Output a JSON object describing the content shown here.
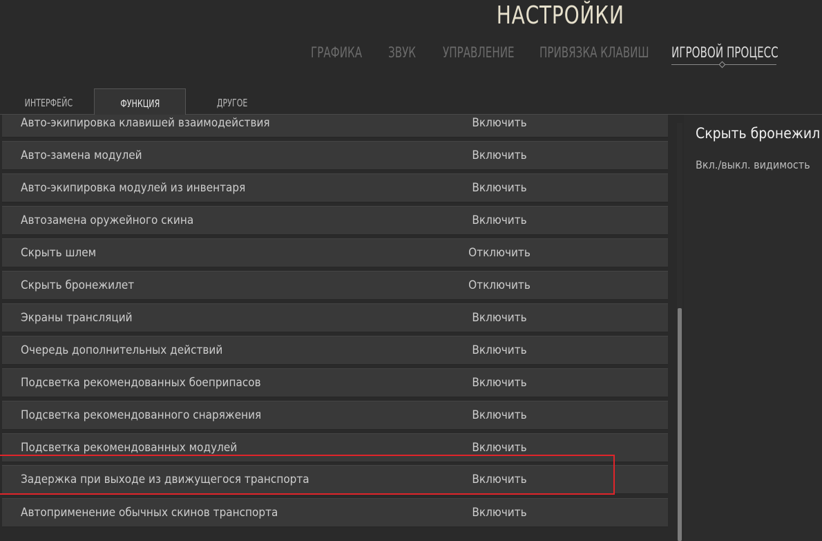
{
  "header": {
    "title": "НАСТРОЙКИ"
  },
  "main_tabs": [
    {
      "label": "ГРАФИКА",
      "active": false
    },
    {
      "label": "ЗВУК",
      "active": false
    },
    {
      "label": "УПРАВЛЕНИЕ",
      "active": false
    },
    {
      "label": "ПРИВЯЗКА КЛАВИШ",
      "active": false
    },
    {
      "label": "ИГРОВОЙ ПРОЦЕСС",
      "active": true
    }
  ],
  "sub_tabs": [
    {
      "label": "ИНТЕРФЕЙС",
      "active": false
    },
    {
      "label": "ФУНКЦИЯ",
      "active": true
    },
    {
      "label": "ДРУГОЕ",
      "active": false
    }
  ],
  "settings": [
    {
      "label": "Авто-экипировка клавишей взаимодействия",
      "value": "Включить"
    },
    {
      "label": "Авто-замена модулей",
      "value": "Включить"
    },
    {
      "label": "Авто-экипировка модулей из инвентаря",
      "value": "Включить"
    },
    {
      "label": "Автозамена оружейного скина",
      "value": "Включить"
    },
    {
      "label": "Скрыть шлем",
      "value": "Отключить"
    },
    {
      "label": "Скрыть бронежилет",
      "value": "Отключить"
    },
    {
      "label": "Экраны трансляций",
      "value": "Включить"
    },
    {
      "label": "Очередь дополнительных действий",
      "value": "Включить"
    },
    {
      "label": "Подсветка рекомендованных боеприпасов",
      "value": "Включить"
    },
    {
      "label": "Подсветка рекомендованного снаряжения",
      "value": "Включить"
    },
    {
      "label": "Подсветка рекомендованных модулей",
      "value": "Включить"
    },
    {
      "label": "Задержка при выходе из движущегося транспорта",
      "value": "Включить",
      "highlighted": true
    },
    {
      "label": "Автоприменение обычных скинов транспорта",
      "value": "Включить"
    }
  ],
  "description": {
    "title": "Скрыть бронежил",
    "text": "Вкл./выкл. видимость"
  },
  "colors": {
    "background": "#2a2a2a",
    "row": "#393939",
    "highlight": "#e0242a",
    "title": "#e6e0cc"
  }
}
